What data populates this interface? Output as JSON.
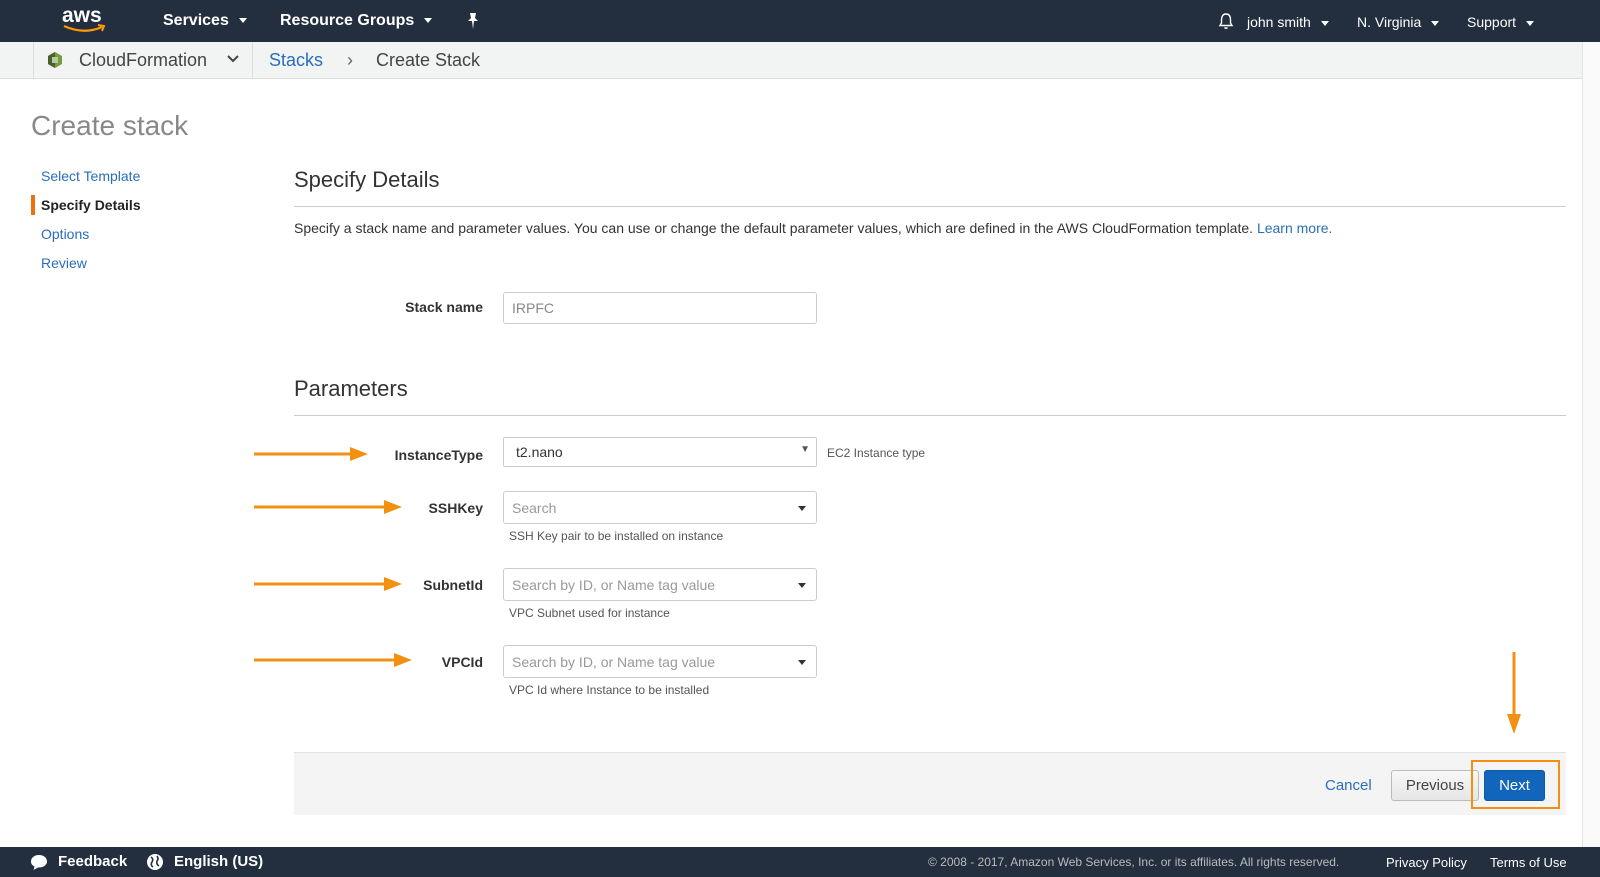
{
  "topnav": {
    "logo_text": "aws",
    "services": "Services",
    "resource_groups": "Resource Groups",
    "user": "john smith",
    "region": "N. Virginia",
    "support": "Support"
  },
  "breadcrumb": {
    "service": "CloudFormation",
    "stacks": "Stacks",
    "separator": "›",
    "current": "Create Stack"
  },
  "page": {
    "title": "Create stack"
  },
  "sidenav": {
    "items": [
      {
        "label": "Select Template"
      },
      {
        "label": "Specify Details"
      },
      {
        "label": "Options"
      },
      {
        "label": "Review"
      }
    ]
  },
  "details": {
    "title": "Specify Details",
    "description": "Specify a stack name and parameter values. You can use or change the default parameter values, which are defined in the AWS CloudFormation template.",
    "learn_more": "Learn more.",
    "stack_name_label": "Stack name",
    "stack_name_value": "IRPFC"
  },
  "parameters": {
    "title": "Parameters",
    "instance_type": {
      "label": "InstanceType",
      "value": "t2.nano",
      "help": "EC2 Instance type"
    },
    "ssh_key": {
      "label": "SSHKey",
      "placeholder": "Search",
      "help": "SSH Key pair to be installed on instance"
    },
    "subnet_id": {
      "label": "SubnetId",
      "placeholder": "Search by ID, or Name tag value",
      "help": "VPC Subnet used for instance"
    },
    "vpc_id": {
      "label": "VPCId",
      "placeholder": "Search by ID, or Name tag value",
      "help": "VPC Id where Instance to be installed"
    }
  },
  "actions": {
    "cancel": "Cancel",
    "previous": "Previous",
    "next": "Next"
  },
  "footer": {
    "feedback": "Feedback",
    "language": "English (US)",
    "copyright": "© 2008 - 2017, Amazon Web Services, Inc. or its affiliates. All rights reserved.",
    "privacy": "Privacy Policy",
    "terms": "Terms of Use"
  },
  "colors": {
    "nav_bg": "#232f3e",
    "link": "#2a6ebb",
    "accent_orange": "#ec7211",
    "annotation_orange": "#f29111",
    "primary_button": "#1166bb"
  }
}
